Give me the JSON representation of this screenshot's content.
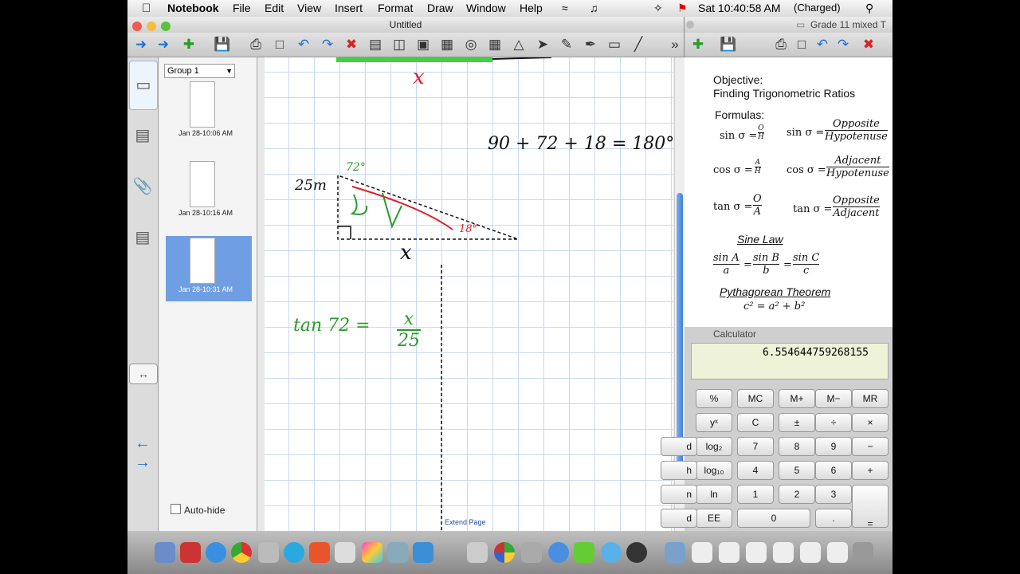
{
  "menubar": {
    "app": "Notebook",
    "items": [
      "File",
      "Edit",
      "View",
      "Insert",
      "Format",
      "Draw",
      "Window",
      "Help"
    ],
    "clock": "Sat 10:40:58 AM",
    "battery": "(Charged)"
  },
  "notebook": {
    "title": "Untitled",
    "group": "Group 1",
    "thumbs": [
      {
        "cap": "Jan 28-10:06 AM"
      },
      {
        "cap": "Jan 28-10:16 AM"
      },
      {
        "cap": "Jan 28-10:31 AM"
      }
    ],
    "autohide": "Auto-hide",
    "extend": "Extend Page",
    "ink": {
      "top_x": "x",
      "angle_sum": "90 + 72 + 18 = 180°",
      "side": "25m",
      "ang72": "72°",
      "ang18": "18°",
      "bottom_x": "x",
      "tan_left": "tan 72 =",
      "tan_num": "x",
      "tan_den": "25"
    }
  },
  "notes": {
    "tab": "Grade 11 mixed T",
    "objective_label": "Objective:",
    "objective": "Finding Trigonometric Ratios",
    "formulas": "Formulas:",
    "sin_l": "sin σ =",
    "sin_n": "O",
    "sin_d": "H",
    "sin_r": "sin σ =",
    "sin_rn": "Opposite",
    "sin_rd": "Hypotenuse",
    "cos_l": "cos σ =",
    "cos_n": "A",
    "cos_d": "H",
    "cos_r": "cos σ =",
    "cos_rn": "Adjacent",
    "cos_rd": "Hypotenuse",
    "tan_l": "tan σ =",
    "tan_n": "O",
    "tan_d": "A",
    "tan_r": "tan σ =",
    "tan_rn": "Opposite",
    "tan_rd": "Adjacent",
    "sine_law": "Sine Law",
    "sl_1n": "sin A",
    "sl_1d": "a",
    "sl_2n": "sin B",
    "sl_2d": "b",
    "sl_3n": "sin C",
    "sl_3d": "c",
    "eq": "=",
    "pyth": "Pythagorean Theorem",
    "pyth_eq": "c² = a² + b²"
  },
  "calculator": {
    "title": "Calculator",
    "display": "6.554644759268155",
    "keys": [
      [
        "%",
        "MC",
        "M+",
        "M−",
        "MR"
      ],
      [
        "yˣ",
        "C",
        "±",
        "÷",
        "×"
      ],
      [
        "log₂",
        "7",
        "8",
        "9",
        "−"
      ],
      [
        "log₁₀",
        "4",
        "5",
        "6",
        "+"
      ],
      [
        "ln",
        "1",
        "2",
        "3",
        ""
      ],
      [
        "EE",
        "0",
        "",
        ".",
        "="
      ]
    ],
    "left_edge": [
      "d",
      "h",
      "n",
      "d"
    ]
  }
}
